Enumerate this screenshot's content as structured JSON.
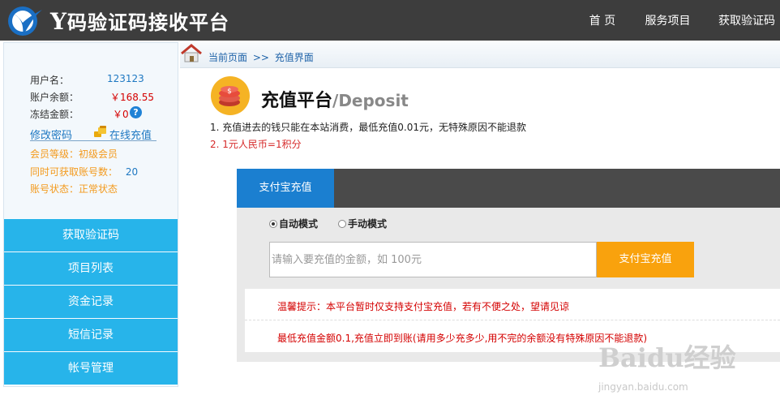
{
  "header": {
    "brand_prefix": "Y",
    "brand_name": "码验证码接收平台",
    "nav": [
      "首 页",
      "服务项目",
      "获取验证码"
    ]
  },
  "user": {
    "username_label": "用户名：",
    "username": "123123",
    "balance_label": "账户余额：",
    "balance": "￥168.55",
    "frozen_label": "冻结金额：",
    "frozen": "￥0",
    "help_icon": "?",
    "change_password": "修改密码",
    "online_recharge": "在线充值",
    "level_label": "会员等级：",
    "level": "初级会员",
    "concurrent_label": "同时可获取账号数：",
    "concurrent": "20",
    "status_label": "账号状态：",
    "status": "正常状态"
  },
  "menu": [
    "获取验证码",
    "项目列表",
    "资金记录",
    "短信记录",
    "帐号管理"
  ],
  "breadcrumb": {
    "current": "当前页面",
    "sep": ">>",
    "page": "充值界面"
  },
  "deposit": {
    "title": "充值平台",
    "subtitle": "/Deposit",
    "note1": "1. 充值进去的钱只能在本站消费，最低充值0.01元，无特殊原因不能退款",
    "note2": "2. 1元人民币=1积分",
    "tab": "支付宝充值",
    "mode_auto": "自动模式",
    "mode_manual": "手动模式",
    "input_placeholder": "请输入要充值的金额，如 100元",
    "pay_button": "支付宝充值",
    "tip1": "温馨提示：本平台暂时仅支持支付宝充值，若有不便之处，望请见谅",
    "tip2": "最低充值金额0.1,充值立即到账(请用多少充多少,用不完的余额没有特殊原因不能退款)"
  },
  "watermark": {
    "main": "Baidu经验",
    "url": "jingyan.baidu.com"
  },
  "colors": {
    "topbar": "#3d3d3d",
    "menu": "#27b4ea",
    "tab_active": "#1b7fd0",
    "pay_button": "#f9a20d",
    "alert_red": "#d40000"
  }
}
